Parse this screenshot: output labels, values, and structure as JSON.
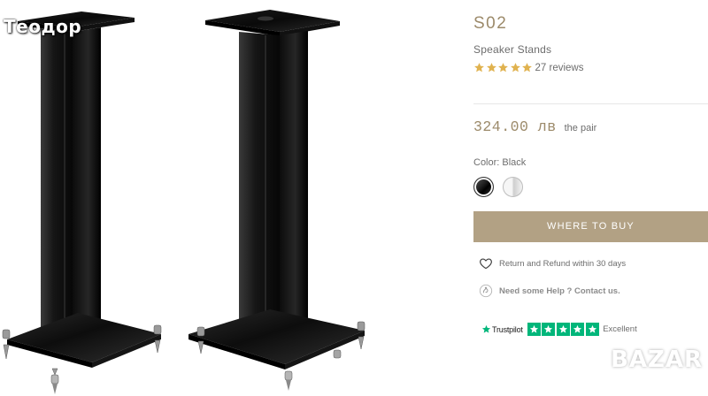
{
  "watermarks": {
    "owner": "Теодор",
    "site": "BAZAR"
  },
  "product": {
    "model": "S02",
    "category": "Speaker Stands",
    "rating_stars": 5,
    "reviews_text": "27 reviews",
    "price": "324.00 лв",
    "price_unit": "the pair",
    "color_label": "Color: Black",
    "swatches": [
      {
        "name": "Black",
        "selected": true
      },
      {
        "name": "White",
        "selected": false
      }
    ],
    "cta_label": "WHERE TO BUY",
    "returns_text": "Return and Refund within 30 days",
    "help_text": "Need some Help ? Contact us.",
    "trustpilot": {
      "brand": "Trustpilot",
      "stars": 5,
      "label": "Excellent"
    }
  },
  "colors": {
    "accent": "#b2a184",
    "title_gold": "#9c8a6a",
    "star_gold": "#e0b24f",
    "trustpilot_green": "#00b67a"
  },
  "icons": {
    "rating": "star-icon",
    "returns": "heart-outline-icon",
    "help": "support-hand-icon",
    "trustpilot": "trustpilot-star-icon"
  }
}
